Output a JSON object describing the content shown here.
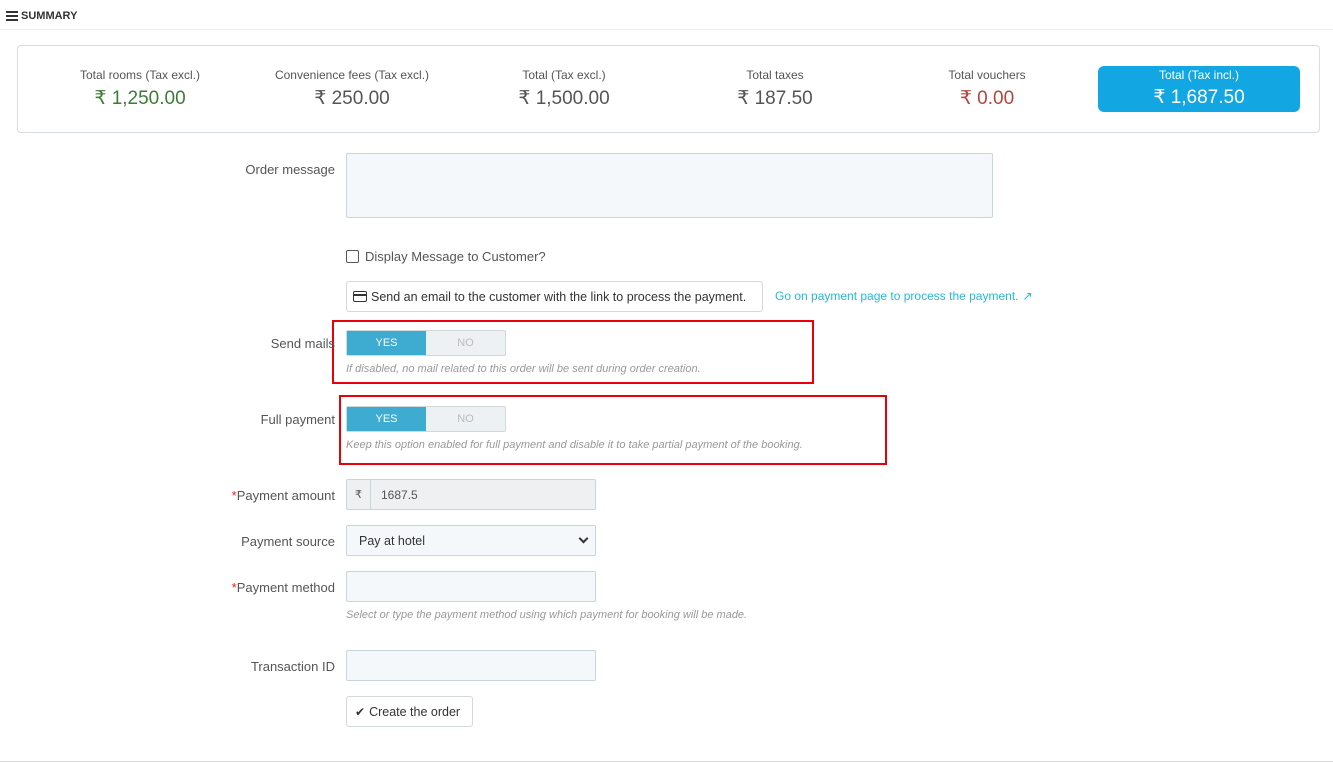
{
  "header": {
    "title": "SUMMARY",
    "icon": "list-icon"
  },
  "summary": {
    "items": [
      {
        "label": "Total rooms (Tax excl.)",
        "value": "₹ 1,250.00",
        "color": "#3c7d36"
      },
      {
        "label": "Convenience fees (Tax excl.)",
        "value": "₹ 250.00"
      },
      {
        "label": "Total (Tax excl.)",
        "value": "₹ 1,500.00"
      },
      {
        "label": "Total taxes",
        "value": "₹ 187.50"
      },
      {
        "label": "Total vouchers",
        "value": "₹ 0.00",
        "color": "#b5453b"
      }
    ],
    "total": {
      "label": "Total (Tax incl.)",
      "value": "₹ 1,687.50",
      "color": "#12a7e2"
    }
  },
  "form": {
    "order_message": {
      "label": "Order message",
      "value": ""
    },
    "display_message": {
      "label": "Display Message to Customer?",
      "checked": false
    },
    "email_button": {
      "label": "Send an email to the customer with the link to process the payment.",
      "icon": "credit-card-icon"
    },
    "payment_link": {
      "label": "Go on payment page to process the payment.",
      "icon": "external-link-icon"
    },
    "send_mails": {
      "label": "Send mails",
      "yes": "YES",
      "no": "NO",
      "value": "YES",
      "help": "If disabled, no mail related to this order will be sent during order creation."
    },
    "full_payment": {
      "label": "Full payment",
      "yes": "YES",
      "no": "NO",
      "value": "YES",
      "help": "Keep this option enabled for full payment and disable it to take partial payment of the booking."
    },
    "payment_amount": {
      "required": "*",
      "label": "Payment amount",
      "currency": "₹",
      "value": "1687.5"
    },
    "payment_source": {
      "label": "Payment source",
      "value": "Pay at hotel"
    },
    "payment_method": {
      "required": "*",
      "label": "Payment method",
      "value": "",
      "help": "Select or type the payment method using which payment for booking will be made."
    },
    "transaction_id": {
      "label": "Transaction ID",
      "value": ""
    },
    "create_button": {
      "label": "Create the order",
      "icon": "check-icon"
    }
  },
  "colors": {
    "accent": "#25b9d7",
    "switch_on": "#3eabd0",
    "highlight_box": "#e8000b"
  }
}
